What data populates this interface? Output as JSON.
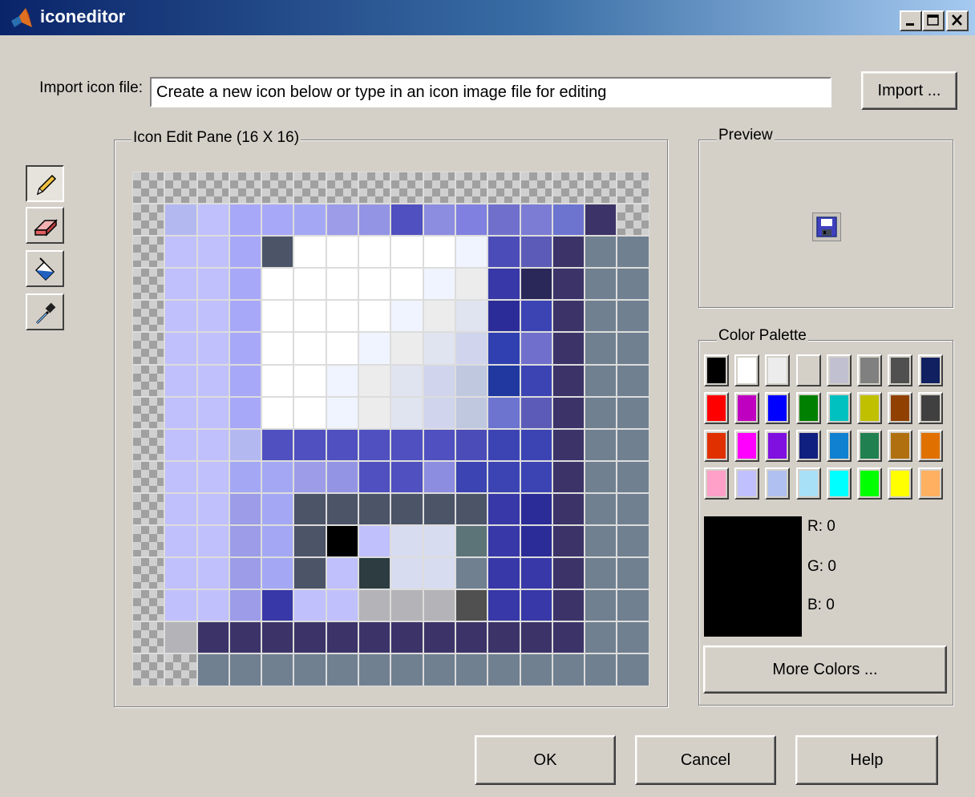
{
  "window": {
    "title": "iconeditor",
    "controls": [
      "minimize-icon",
      "maximize-icon",
      "close-icon"
    ]
  },
  "import": {
    "label": "Import icon file:",
    "value": "Create a new icon below or type in an icon image file for editing",
    "button": "Import ..."
  },
  "tools": [
    {
      "name": "pencil-icon",
      "pressed": true
    },
    {
      "name": "eraser-icon",
      "pressed": false
    },
    {
      "name": "paint-bucket-icon",
      "pressed": false
    },
    {
      "name": "eyedropper-icon",
      "pressed": false
    }
  ],
  "edit_pane": {
    "title": "Icon Edit Pane (16 X 16)",
    "rows": [
      "TTTTTTTTTTTTTTTT",
      "TabccdefghiktnLT",
      "TbbcDWWWWWVmoLGG",
      "TbbcWWWWWVUpKLGG",
      "TbbcWWWWVUQqjLGG",
      "TbbcWWWVUQPrkLGG",
      "TbbcWWVUQPSsjLGG",
      "TbbcWWVUQPSnoLGG",
      "TbbaggggggmjjLGG",
      "TbbddefgghjjjLGG",
      "TbbedDDDDDDpqLGG",
      "TbbedDBbXXxpqLGG",
      "TbbedDbZXXGppLGG",
      "TbbepbbJJJNppLGG",
      "TJLLLLLLLLLLLLGG",
      "TTGGGGGGGGGGGGGG"
    ],
    "colors": {
      "a": "#b4b8f0",
      "b": "#c0c0fc",
      "c": "#a8a8f8",
      "d": "#a4a8f4",
      "e": "#9c9ce8",
      "f": "#9494e4",
      "g": "#5050c0",
      "h": "#8c8ce0",
      "i": "#8080e0",
      "j": "#3c44b4",
      "k": "#7070cc",
      "m": "#4c4cb8",
      "n": "#6c74d0",
      "o": "#5c5cb8",
      "p": "#3838a8",
      "q": "#2c2c98",
      "r": "#3040b0",
      "s": "#2038a0",
      "t": "#7c7cd4",
      "L": "#3c3468",
      "G": "#708090",
      "W": "#ffffff",
      "V": "#f0f4ff",
      "U": "#ececec",
      "Q": "#e0e4f0",
      "P": "#d0d4ec",
      "S": "#c0c8e0",
      "K": "#2a2858",
      "D": "#4c5468",
      "B": "#000000",
      "X": "#d8dcf0",
      "x": "#5c7478",
      "Z": "#2c3c40",
      "J": "#b4b4b8",
      "N": "#505050"
    }
  },
  "preview": {
    "title": "Preview"
  },
  "palette": {
    "title": "Color Palette",
    "colors": [
      "#000000",
      "#ffffff",
      "#ececec",
      "#d4d0c8",
      "#c0c0d0",
      "#808080",
      "#505050",
      "#102060",
      "#ff0000",
      "#c000c0",
      "#0000ff",
      "#008000",
      "#00c0c0",
      "#c0c000",
      "#904000",
      "#404040",
      "#e03000",
      "#ff00ff",
      "#8010e0",
      "#102080",
      "#1080d0",
      "#208050",
      "#b07010",
      "#e07000",
      "#ffa0c8",
      "#c0c0ff",
      "#b0c0f0",
      "#a8e0f8",
      "#00ffff",
      "#00ff00",
      "#ffff00",
      "#ffb060"
    ],
    "current": {
      "r_label": "R: 0",
      "g_label": "G: 0",
      "b_label": "B: 0"
    },
    "more_button": "More Colors ..."
  },
  "footer": {
    "ok": "OK",
    "cancel": "Cancel",
    "help": "Help"
  }
}
